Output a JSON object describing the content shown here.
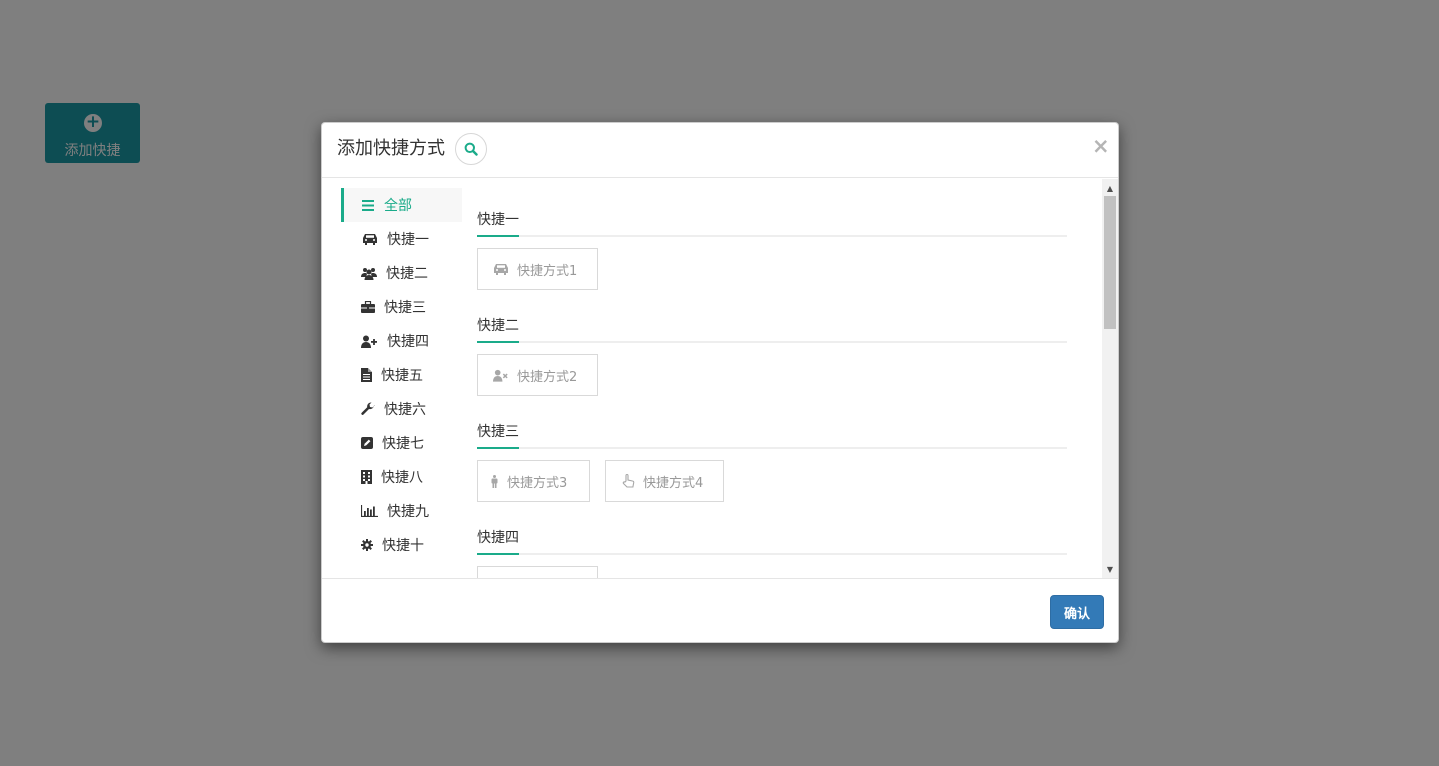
{
  "background": {
    "add_tile_label": "添加快捷",
    "add_tile_color": "#1b9aa7"
  },
  "modal": {
    "title": "添加快捷方式",
    "close_symbol": "×",
    "confirm_label": "确认",
    "accent_color": "#1aab8a",
    "nav": [
      {
        "label": "全部",
        "icon": "bars-icon",
        "active": true
      },
      {
        "label": "快捷一",
        "icon": "car-icon"
      },
      {
        "label": "快捷二",
        "icon": "users-icon"
      },
      {
        "label": "快捷三",
        "icon": "briefcase-icon"
      },
      {
        "label": "快捷四",
        "icon": "user-plus-icon"
      },
      {
        "label": "快捷五",
        "icon": "file-icon"
      },
      {
        "label": "快捷六",
        "icon": "wrench-icon"
      },
      {
        "label": "快捷七",
        "icon": "edit-icon"
      },
      {
        "label": "快捷八",
        "icon": "building-icon"
      },
      {
        "label": "快捷九",
        "icon": "bar-chart-icon"
      },
      {
        "label": "快捷十",
        "icon": "gear-icon"
      }
    ],
    "groups": [
      {
        "title": "快捷一",
        "items": [
          {
            "label": "快捷方式1",
            "icon": "car-icon"
          }
        ]
      },
      {
        "title": "快捷二",
        "items": [
          {
            "label": "快捷方式2",
            "icon": "user-times-icon"
          }
        ]
      },
      {
        "title": "快捷三",
        "items": [
          {
            "label": "快捷方式3",
            "icon": "male-icon"
          },
          {
            "label": "快捷方式4",
            "icon": "hand-pointer-icon"
          }
        ]
      },
      {
        "title": "快捷四",
        "items": [
          {
            "label": "",
            "icon": ""
          }
        ]
      }
    ]
  }
}
